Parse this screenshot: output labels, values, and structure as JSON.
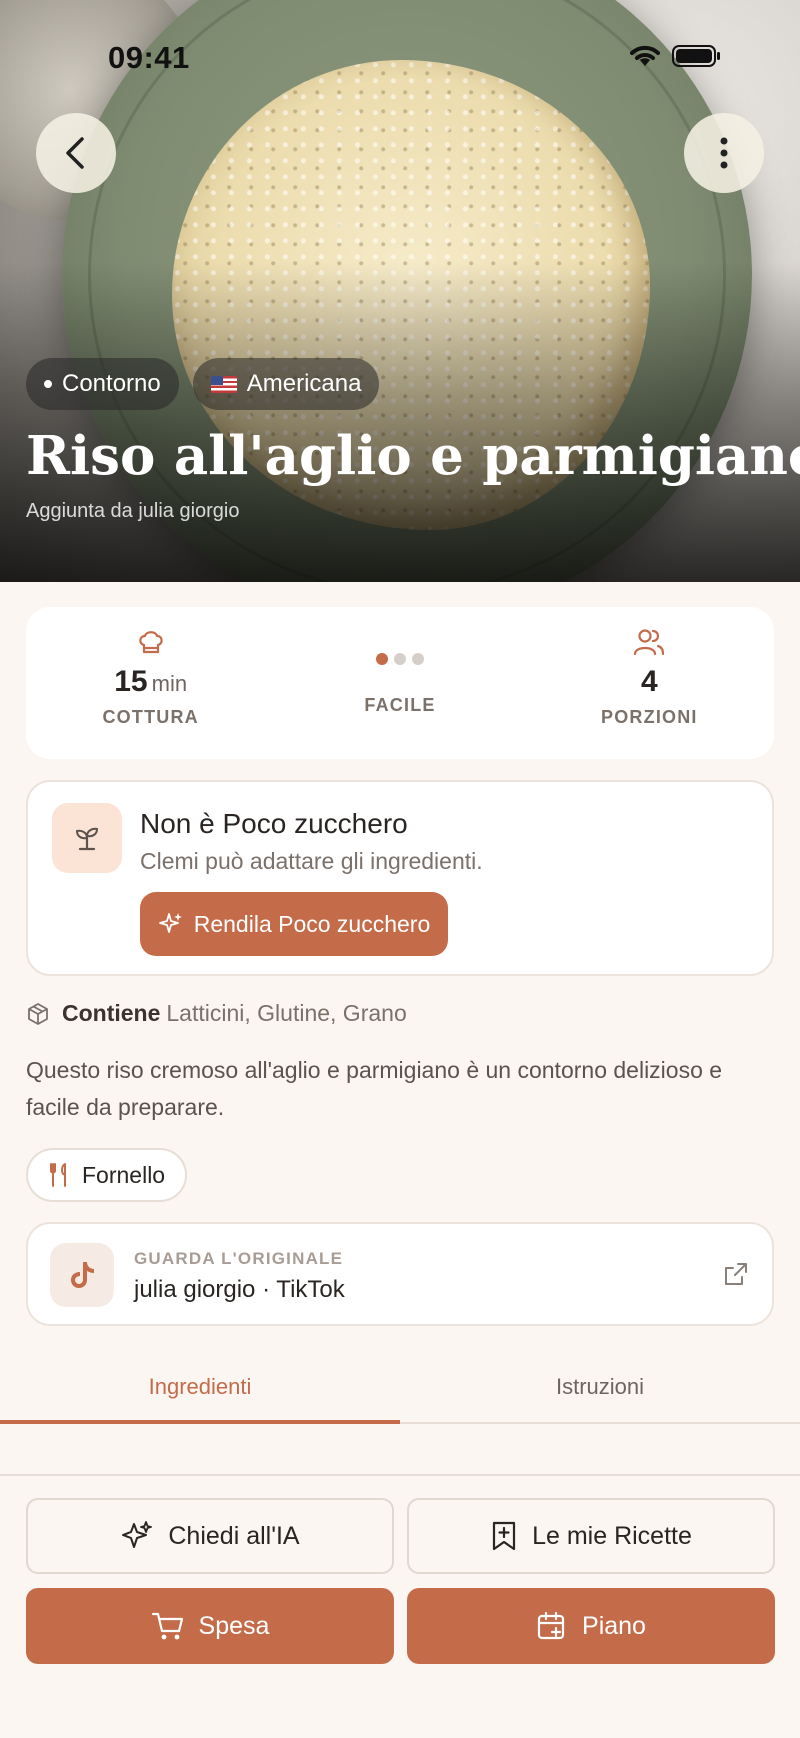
{
  "status": {
    "time": "09:41"
  },
  "hero": {
    "tags": [
      {
        "label": "Contorno"
      },
      {
        "label": "Americana"
      }
    ],
    "title": "Riso all'aglio e parmigiano",
    "added_by": "Aggiunta da julia giorgio"
  },
  "stats": {
    "time": {
      "value": "15",
      "unit": "min",
      "label": "COTTURA"
    },
    "difficulty": {
      "label": "FACILE",
      "level": 1,
      "max": 3
    },
    "servings": {
      "value": "4",
      "label": "PORZIONI"
    }
  },
  "adapt": {
    "title": "Non è Poco zucchero",
    "description": "Clemi può adattare gli ingredienti.",
    "button": "Rendila Poco zucchero"
  },
  "allergens": {
    "label": "Contiene",
    "list": "Latticini, Glutine, Grano"
  },
  "description": "Questo riso cremoso all'aglio e parmigiano è un contorno delizioso e facile da preparare.",
  "equipment": {
    "label": "Fornello"
  },
  "source": {
    "kicker": "GUARDA L'ORIGINALE",
    "name": "julia giorgio · TikTok"
  },
  "tabs": [
    {
      "label": "Ingredienti"
    },
    {
      "label": "Istruzioni"
    }
  ],
  "bottom": {
    "ask_ai": "Chiedi all'IA",
    "my_recipes": "Le mie Ricette",
    "shopping": "Spesa",
    "plan": "Piano"
  },
  "colors": {
    "accent": "#c46c4a",
    "background": "#fbf6f1",
    "card": "#ffffff"
  }
}
